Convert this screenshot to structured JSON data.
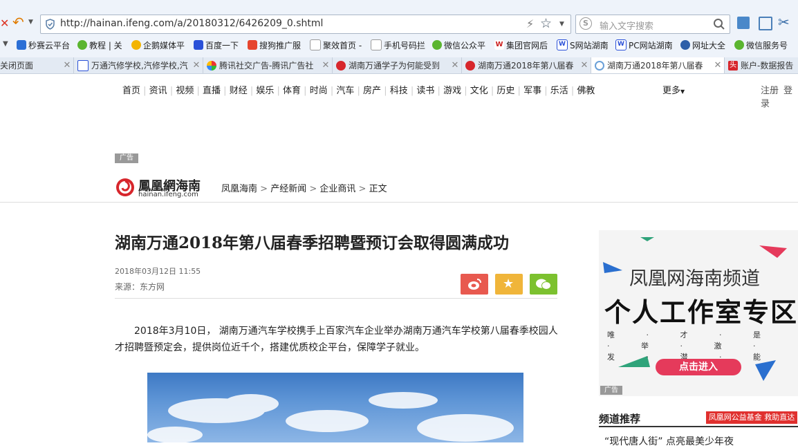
{
  "browser": {
    "url": "http://hainan.ifeng.com/a/20180312/6426209_0.shtml",
    "search_placeholder": "输入文字搜索",
    "bookmarks": [
      "秒赛云平台",
      "教程 | 关",
      "企鹅媒体平",
      "百度一下",
      "搜狗推广服",
      "聚效首页 -",
      "手机号码拦",
      "微信公众平",
      "集团官网后",
      "S网站湖南",
      "PC网站湖南",
      "网址大全",
      "微信服务号"
    ],
    "tabs": [
      {
        "label": "关闭页面",
        "active": false
      },
      {
        "label": "万通汽修学校,汽修学校,汽",
        "active": false
      },
      {
        "label": "腾讯社交广告-腾讯广告社",
        "active": false
      },
      {
        "label": "湖南万通学子为何能受到",
        "active": false
      },
      {
        "label": "湖南万通2018年第八届春",
        "active": false
      },
      {
        "label": "湖南万通2018年第八届春",
        "active": true
      },
      {
        "label": "账户-数据报告",
        "active": false
      }
    ]
  },
  "site_nav": {
    "items": [
      "首页",
      "资讯",
      "视频",
      "直播",
      "财经",
      "娱乐",
      "体育",
      "时尚",
      "汽车",
      "房产",
      "科技",
      "读书",
      "游戏",
      "文化",
      "历史",
      "军事",
      "乐活",
      "佛教"
    ],
    "more": "更多",
    "register": "注册",
    "login": "登录"
  },
  "ad_tag": "广告",
  "logo": {
    "cn": "鳳凰網海南",
    "en": "hainan.ifeng.com"
  },
  "breadcrumb": [
    "凤凰海南",
    "产经新闻",
    "企业商讯",
    "正文"
  ],
  "article": {
    "title": "湖南万通2018年第八届春季招聘暨预订会取得圆满成功",
    "date": "2018年03月12日  11:55",
    "source": "来源：东方网",
    "paragraph": "2018年3月10日， 湖南万通汽车学校携手上百家汽车企业举办湖南万通汽车学校第八届春季校园人才招聘暨预定会，提供岗位近千个，搭建优质校企平台，保障学子就业。"
  },
  "right_ad": {
    "title": "凤凰网海南频道",
    "headline": "个人工作室专区",
    "sub": "唯 · 才 · 是 · 举 · 激 · 发 · 潜 · 能",
    "button": "点击进入",
    "tag": "广告"
  },
  "recommend": {
    "title": "频道推荐",
    "fund_button": "凤凰网公益基金  救助直达",
    "first_item": "“现代唐人街” 点亮最美少年夜"
  },
  "colors": {
    "weibo": "#e8594f",
    "fav": "#f0b53a",
    "wechat": "#7cc12f",
    "accent_red": "#e0302e"
  }
}
